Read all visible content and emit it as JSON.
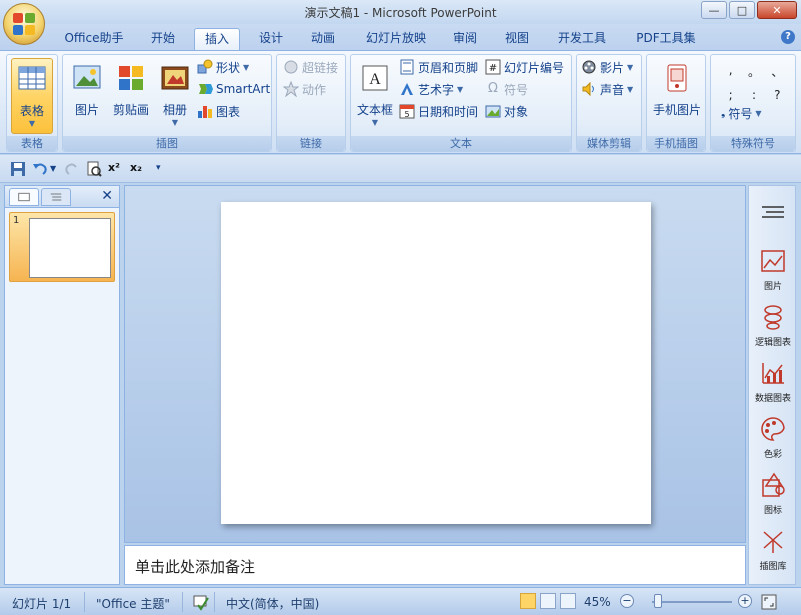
{
  "window": {
    "title": "演示文稿1 - Microsoft PowerPoint",
    "minimize": "—",
    "restore": "□",
    "close": "✕"
  },
  "tabs": [
    "Office助手",
    "开始",
    "插入",
    "设计",
    "动画",
    "幻灯片放映",
    "审阅",
    "视图",
    "开发工具",
    "PDF工具集"
  ],
  "active_tab": "插入",
  "ribbon": {
    "groups": {
      "table": "表格",
      "illustrations": "插图",
      "links": "链接",
      "text": "文本",
      "media": "媒体剪辑",
      "phone": "手机插图",
      "special": "特殊符号"
    },
    "table_btn": "表格",
    "picture": "图片",
    "clipart": "剪贴画",
    "album": "相册",
    "shapes": "形状",
    "smartart": "SmartArt",
    "chart": "图表",
    "hyperlink": "超链接",
    "action": "动作",
    "textbox": "文本框",
    "header_footer": "页眉和页脚",
    "wordart": "艺术字",
    "datetime": "日期和时间",
    "slide_number": "幻灯片编号",
    "symbol": "符号",
    "object": "对象",
    "movie": "影片",
    "sound": "声音",
    "phone_picture": "手机图片",
    "symbols_btn": "符号",
    "symbol_grid": [
      ",",
      "。",
      "、",
      ";",
      ":",
      "?"
    ]
  },
  "qat": {
    "superscript": "x²",
    "subscript": "x₂"
  },
  "notes_placeholder": "单击此处添加备注",
  "slide_thumb_number": "1",
  "right_panel": [
    "图片",
    "逻辑图表",
    "数据图表",
    "色彩",
    "图标",
    "插图库"
  ],
  "status": {
    "slide": "幻灯片 1/1",
    "theme": "\"Office 主题\"",
    "language": "中文(简体，中国)",
    "zoom": "45%"
  },
  "colors": {
    "ribbon_blue": "#15428b",
    "highlight": "#ffd466",
    "background": "#bcd3ee"
  }
}
